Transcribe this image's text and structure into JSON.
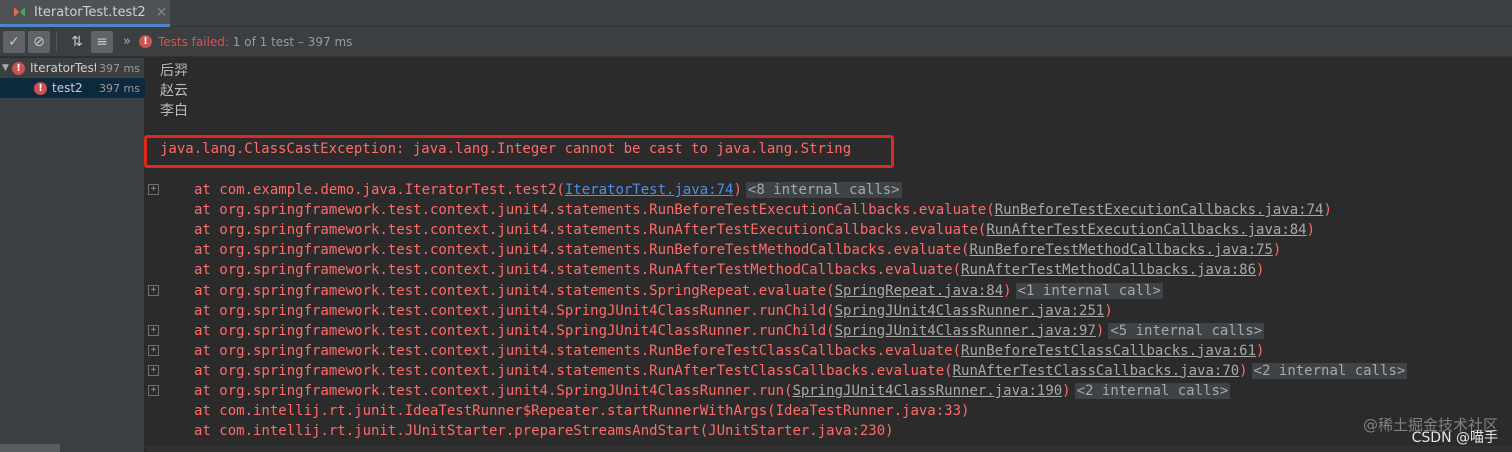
{
  "tab": {
    "title": "IteratorTest.test2",
    "close": "×"
  },
  "toolbar": {
    "status_fail": "Tests failed:",
    "status_rest": " 1 of 1 test – 397 ms",
    "more": "»"
  },
  "tree": {
    "items": [
      {
        "name": "IteratorTest",
        "time": "397 ms"
      },
      {
        "name": "test2",
        "time": "397 ms"
      }
    ]
  },
  "console": {
    "output": [
      "后羿",
      "赵云",
      "李白"
    ],
    "exception": "java.lang.ClassCastException: java.lang.Integer cannot be cast to java.lang.String",
    "stack": [
      {
        "prefix": "at com.example.demo.java.IteratorTest.test2(",
        "link": "IteratorTest.java:74",
        "suffix": ")",
        "internal": "<8 internal calls>",
        "fold": true,
        "blue": true
      },
      {
        "prefix": "at org.springframework.test.context.junit4.statements.RunBeforeTestExecutionCallbacks.evaluate(",
        "link": "RunBeforeTestExecutionCallbacks.java:74",
        "suffix": ")",
        "internal": "",
        "fold": false
      },
      {
        "prefix": "at org.springframework.test.context.junit4.statements.RunAfterTestExecutionCallbacks.evaluate(",
        "link": "RunAfterTestExecutionCallbacks.java:84",
        "suffix": ")",
        "internal": "",
        "fold": false
      },
      {
        "prefix": "at org.springframework.test.context.junit4.statements.RunBeforeTestMethodCallbacks.evaluate(",
        "link": "RunBeforeTestMethodCallbacks.java:75",
        "suffix": ")",
        "internal": "",
        "fold": false
      },
      {
        "prefix": "at org.springframework.test.context.junit4.statements.RunAfterTestMethodCallbacks.evaluate(",
        "link": "RunAfterTestMethodCallbacks.java:86",
        "suffix": ")",
        "internal": "",
        "fold": false
      },
      {
        "prefix": "at org.springframework.test.context.junit4.statements.SpringRepeat.evaluate(",
        "link": "SpringRepeat.java:84",
        "suffix": ")",
        "internal": "<1 internal call>",
        "fold": true
      },
      {
        "prefix": "at org.springframework.test.context.junit4.SpringJUnit4ClassRunner.runChild(",
        "link": "SpringJUnit4ClassRunner.java:251",
        "suffix": ")",
        "internal": "",
        "fold": false
      },
      {
        "prefix": "at org.springframework.test.context.junit4.SpringJUnit4ClassRunner.runChild(",
        "link": "SpringJUnit4ClassRunner.java:97",
        "suffix": ")",
        "internal": "<5 internal calls>",
        "fold": true
      },
      {
        "prefix": "at org.springframework.test.context.junit4.statements.RunBeforeTestClassCallbacks.evaluate(",
        "link": "RunBeforeTestClassCallbacks.java:61",
        "suffix": ")",
        "internal": "",
        "fold": true
      },
      {
        "prefix": "at org.springframework.test.context.junit4.statements.RunAfterTestClassCallbacks.evaluate(",
        "link": "RunAfterTestClassCallbacks.java:70",
        "suffix": ")",
        "internal": "<2 internal calls>",
        "fold": true
      },
      {
        "prefix": "at org.springframework.test.context.junit4.SpringJUnit4ClassRunner.run(",
        "link": "SpringJUnit4ClassRunner.java:190",
        "suffix": ")",
        "internal": "<2 internal calls>",
        "fold": true
      },
      {
        "prefix": "at com.intellij.rt.junit.IdeaTestRunner$Repeater.startRunnerWithArgs(IdeaTestRunner.java:33)",
        "link": "",
        "suffix": "",
        "internal": "",
        "fold": false
      },
      {
        "prefix": "at com.intellij.rt.junit.JUnitStarter.prepareStreamsAndStart(JUnitStarter.java:230)",
        "link": "",
        "suffix": "",
        "internal": "",
        "fold": false
      }
    ]
  },
  "watermark": "@稀土掘金技术社区",
  "watermark2": "CSDN @喵手"
}
